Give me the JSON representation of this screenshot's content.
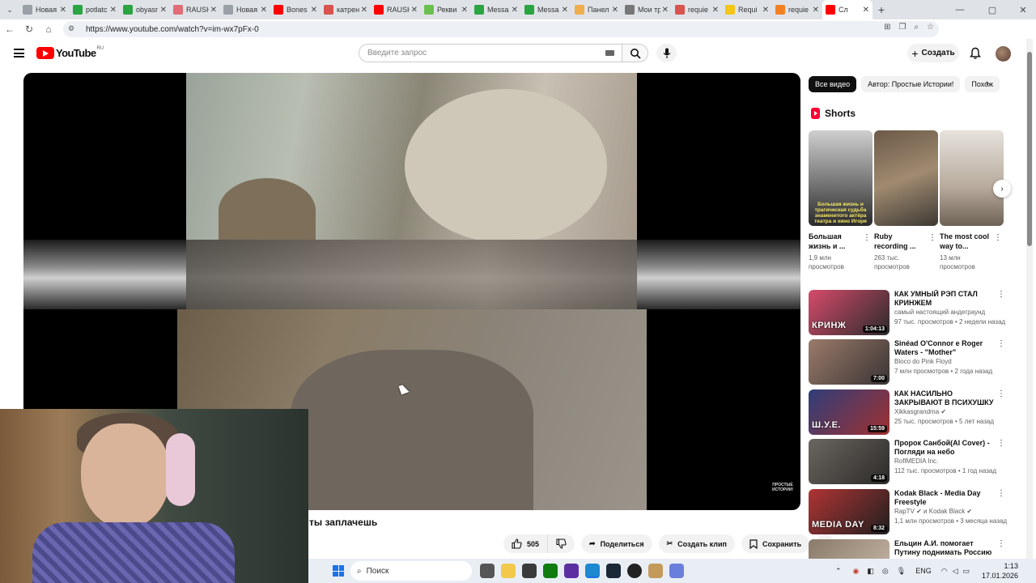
{
  "browser": {
    "tabs": [
      {
        "label": "Новая",
        "color": "#9aa0a6"
      },
      {
        "label": "potlatc",
        "color": "#2aa541"
      },
      {
        "label": "obyasr",
        "color": "#2aa541"
      },
      {
        "label": "RAUSH",
        "color": "#e06c75"
      },
      {
        "label": "Новая",
        "color": "#9aa0a6"
      },
      {
        "label": "Bones",
        "color": "#ff0000"
      },
      {
        "label": "катрен",
        "color": "#d9534f"
      },
      {
        "label": "RAUSH",
        "color": "#ff0000"
      },
      {
        "label": "Рекви",
        "color": "#6bbf4e"
      },
      {
        "label": "Messa",
        "color": "#2aa541"
      },
      {
        "label": "Messa",
        "color": "#2aa541"
      },
      {
        "label": "Панел",
        "color": "#f0ad4e"
      },
      {
        "label": "Мои тр",
        "color": "#777777"
      },
      {
        "label": "requie",
        "color": "#d9534f"
      },
      {
        "label": "Requi",
        "color": "#f5c518"
      },
      {
        "label": "requie",
        "color": "#f48024"
      },
      {
        "label": "Сл",
        "color": "#ff0000"
      }
    ],
    "url": "https://www.youtube.com/watch?v=im-wx7pFx-0"
  },
  "yt": {
    "logo_text": "YouTube",
    "region": "RU",
    "search_placeholder": "Введите запрос",
    "create_label": "Создать"
  },
  "player": {
    "watermark": "ПРОСТЫЕ ИСТОРИИ!"
  },
  "video": {
    "title_visible": "ты заплачешь",
    "likes": "505",
    "share_label": "Поделиться",
    "clip_label": "Создать клип",
    "save_label": "Сохранить"
  },
  "sidebar": {
    "chips": [
      "Все видео",
      "Автор: Простые Истории!",
      "Похож"
    ],
    "shorts_heading": "Shorts",
    "shorts": [
      {
        "title": "Большая жизнь и ...",
        "views": "1,9 млн просмотров",
        "thumb_text": "Большая жизнь и трагическая судьба знаменитого актёра театра и кино Игоря"
      },
      {
        "title": "Ruby recording ...",
        "views": "263 тыс. просмотров",
        "thumb_text": ""
      },
      {
        "title": "The most cool way to...",
        "views": "13 млн просмотров",
        "thumb_text": ""
      }
    ],
    "recommendations": [
      {
        "title": "КАК УМНЫЙ РЭП СТАЛ КРИНЖЕМ",
        "channel": "самый настоящий андеграунд",
        "meta": "97 тыс. просмотров • 2 недели назад",
        "duration": "1:04:13",
        "thumb_text": "КРИНЖ",
        "colors": [
          "#d64b6b",
          "#2b2b2b"
        ]
      },
      {
        "title": "Sinéad O'Connor e Roger Waters - \"Mother\"",
        "channel": "Bloco do Pink Floyd",
        "meta": "7 млн просмотров • 2 года назад",
        "duration": "7:00",
        "thumb_text": "",
        "colors": [
          "#9b7b6a",
          "#3a3434"
        ]
      },
      {
        "title": "КАК НАСИЛЬНО ЗАКРЫВАЮТ В ПСИХУШКУ ? | ХИККАН №...",
        "channel": "Xikkasgrandma ✔",
        "meta": "25 тыс. просмотров • 5 лет назад",
        "duration": "15:59",
        "thumb_text": "Ш.У.Е.",
        "colors": [
          "#2f3e7a",
          "#a03030"
        ]
      },
      {
        "title": "Пророк Санбой(AI Cover) - Погляди на небо",
        "channel": "RoflMEDIA Inc.",
        "meta": "112 тыс. просмотров • 1 год назад",
        "duration": "4:18",
        "thumb_text": "",
        "colors": [
          "#6a6660",
          "#2c2a28"
        ]
      },
      {
        "title": "Kodak Black - Media Day Freestyle",
        "channel": "RapTV ✔ и Kodak Black ✔",
        "meta": "1,1 млн просмотров • 3 месяца назад",
        "duration": "8:32",
        "thumb_text": "MEDIA DAY",
        "colors": [
          "#b03434",
          "#1f1f1f"
        ]
      },
      {
        "title": "Ельцин А.И. помогает Путину поднимать Россию",
        "channel": "",
        "meta": "",
        "duration": "",
        "thumb_text": "",
        "colors": [
          "#8a7a6a",
          "#c9b9a8"
        ]
      }
    ]
  },
  "taskbar": {
    "search_label": "Поиск",
    "lang": "ENG",
    "time": "1:13",
    "date": "17.01.2026"
  }
}
